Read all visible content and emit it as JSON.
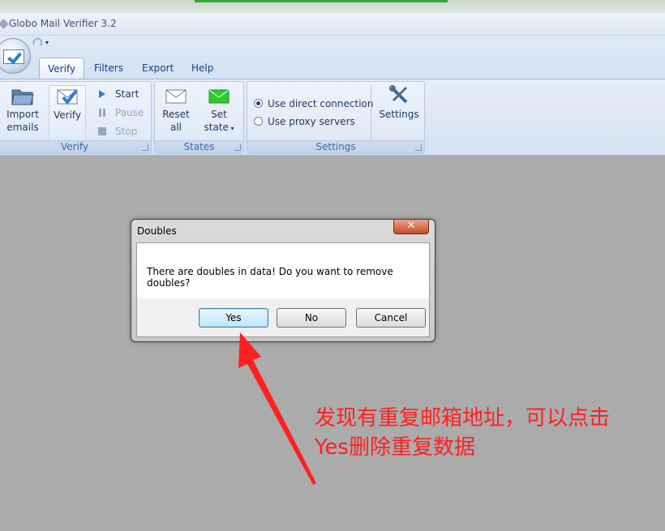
{
  "window": {
    "title": "Globo Mail Verifier 3.2"
  },
  "tabs": [
    {
      "label": "Verify",
      "active": true
    },
    {
      "label": "Filters",
      "active": false
    },
    {
      "label": "Export",
      "active": false
    },
    {
      "label": "Help",
      "active": false
    }
  ],
  "ribbon": {
    "verify_group": {
      "label": "Verify",
      "import_label_line1": "Import",
      "import_label_line2": "emails",
      "verify_label": "Verify",
      "start_label": "Start",
      "pause_label": "Pause",
      "stop_label": "Stop"
    },
    "states_group": {
      "label": "States",
      "reset_line1": "Reset",
      "reset_line2": "all",
      "set_line1": "Set",
      "set_line2": "state"
    },
    "settings_group": {
      "label": "Settings",
      "direct_label": "Use direct connection",
      "proxy_label": "Use proxy servers",
      "selected": "direct",
      "settings_label": "Settings"
    }
  },
  "dialog": {
    "title": "Doubles",
    "close_glyph": "✕",
    "message": "There are doubles in data! Do you want to remove doubles?",
    "buttons": {
      "yes": "Yes",
      "no": "No",
      "cancel": "Cancel"
    },
    "default_button": "yes"
  },
  "annotation": {
    "line1": "发现有重复邮箱地址，可以点击",
    "line2": "Yes删除重复数据",
    "color": "#ff2020"
  },
  "colors": {
    "ribbon_text": "#1e395b",
    "tab_text": "#15428b",
    "workspace": "#ababab",
    "accent_blue": "#2f7fd0",
    "state_green": "#2ecc2e"
  }
}
